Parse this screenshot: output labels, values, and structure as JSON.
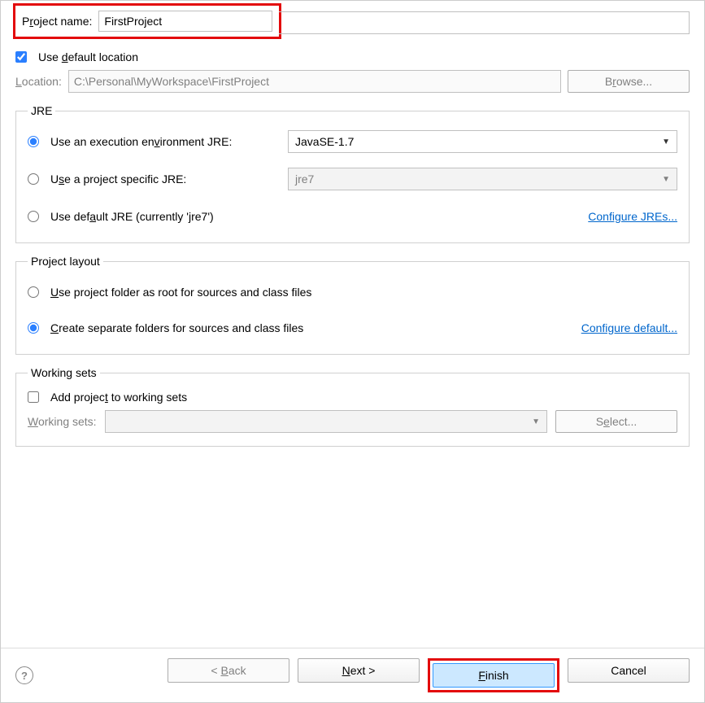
{
  "projectName": {
    "label_pre": "P",
    "label_mn": "r",
    "label_post": "oject name:",
    "value": "FirstProject"
  },
  "location": {
    "use_default_pre": "Use ",
    "use_default_mn": "d",
    "use_default_post": "efault location",
    "label_mn": "L",
    "label_post": "ocation:",
    "value": "C:\\Personal\\MyWorkspace\\FirstProject",
    "browse_pre": "B",
    "browse_mn": "r",
    "browse_post": "owse..."
  },
  "jre": {
    "legend": "JRE",
    "opt1_pre": "Use an execution en",
    "opt1_mn": "v",
    "opt1_post": "ironment JRE:",
    "opt1_value": "JavaSE-1.7",
    "opt2_pre": "U",
    "opt2_mn": "s",
    "opt2_post": "e a project specific JRE:",
    "opt2_value": "jre7",
    "opt3_pre": "Use def",
    "opt3_mn": "a",
    "opt3_post": "ult JRE (currently 'jre7')",
    "configure": "Configure JREs..."
  },
  "layout": {
    "legend": "Project layout",
    "opt1_mn": "U",
    "opt1_post": "se project folder as root for sources and class files",
    "opt2_mn": "C",
    "opt2_post": "reate separate folders for sources and class files",
    "configure": "Configure default..."
  },
  "workingSets": {
    "legend": "Working sets",
    "add_pre": "Add projec",
    "add_mn": "t",
    "add_post": " to working sets",
    "label_pre": "W",
    "label_mn": "o",
    "label_post": "rking sets:",
    "select_pre": "S",
    "select_mn": "e",
    "select_post": "lect..."
  },
  "footer": {
    "back_pre": "< ",
    "back_mn": "B",
    "back_post": "ack",
    "next_mn": "N",
    "next_post": "ext >",
    "finish_mn": "F",
    "finish_post": "inish",
    "cancel": "Cancel"
  }
}
